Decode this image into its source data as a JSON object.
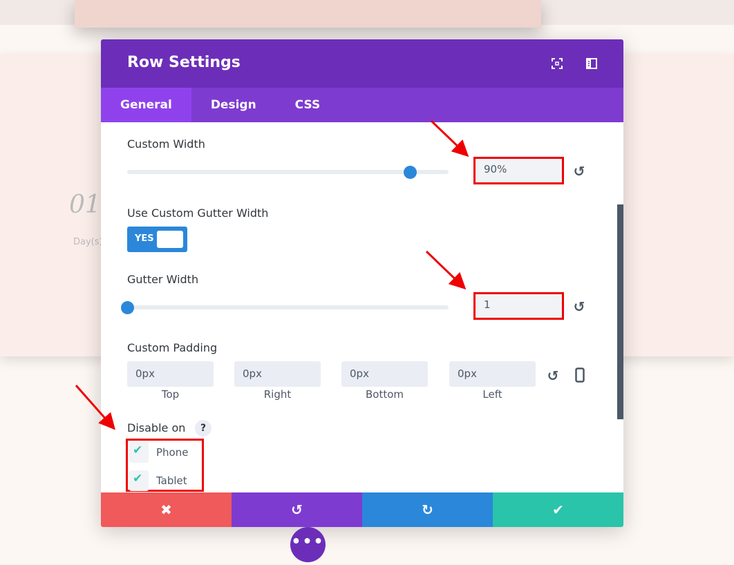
{
  "background": {
    "number": "01",
    "label": "Day(s)"
  },
  "modal": {
    "title": "Row Settings",
    "header_icons": [
      "expand-icon",
      "sidebar-layout-icon"
    ],
    "tabs": [
      {
        "label": "General",
        "active": true
      },
      {
        "label": "Design"
      },
      {
        "label": "CSS"
      }
    ],
    "custom_width": {
      "label": "Custom Width",
      "value": "90%",
      "slider_fraction": 0.88
    },
    "use_custom_gutter": {
      "label": "Use Custom Gutter Width",
      "toggle_text": "YES",
      "on": true
    },
    "gutter_width": {
      "label": "Gutter Width",
      "value": "1",
      "slider_fraction": 0
    },
    "custom_padding": {
      "label": "Custom Padding",
      "fields": [
        {
          "value": "0px",
          "label": "Top"
        },
        {
          "value": "0px",
          "label": "Right"
        },
        {
          "value": "0px",
          "label": "Bottom"
        },
        {
          "value": "0px",
          "label": "Left"
        }
      ]
    },
    "disable_on": {
      "label": "Disable on",
      "help": "?",
      "options": [
        {
          "label": "Phone",
          "checked": true
        },
        {
          "label": "Tablet",
          "checked": true
        }
      ]
    },
    "footer": {
      "cancel": "✖",
      "undo": "↺",
      "redo": "↻",
      "save": "✔"
    },
    "colors": {
      "header": "#6c2eb9",
      "tabs": "#7e3bd0",
      "cancel": "#f05a5a",
      "undo": "#7e3bd0",
      "redo": "#2b87da",
      "save": "#29c4a9",
      "highlight": "#e00000"
    }
  },
  "more_button": "•••"
}
